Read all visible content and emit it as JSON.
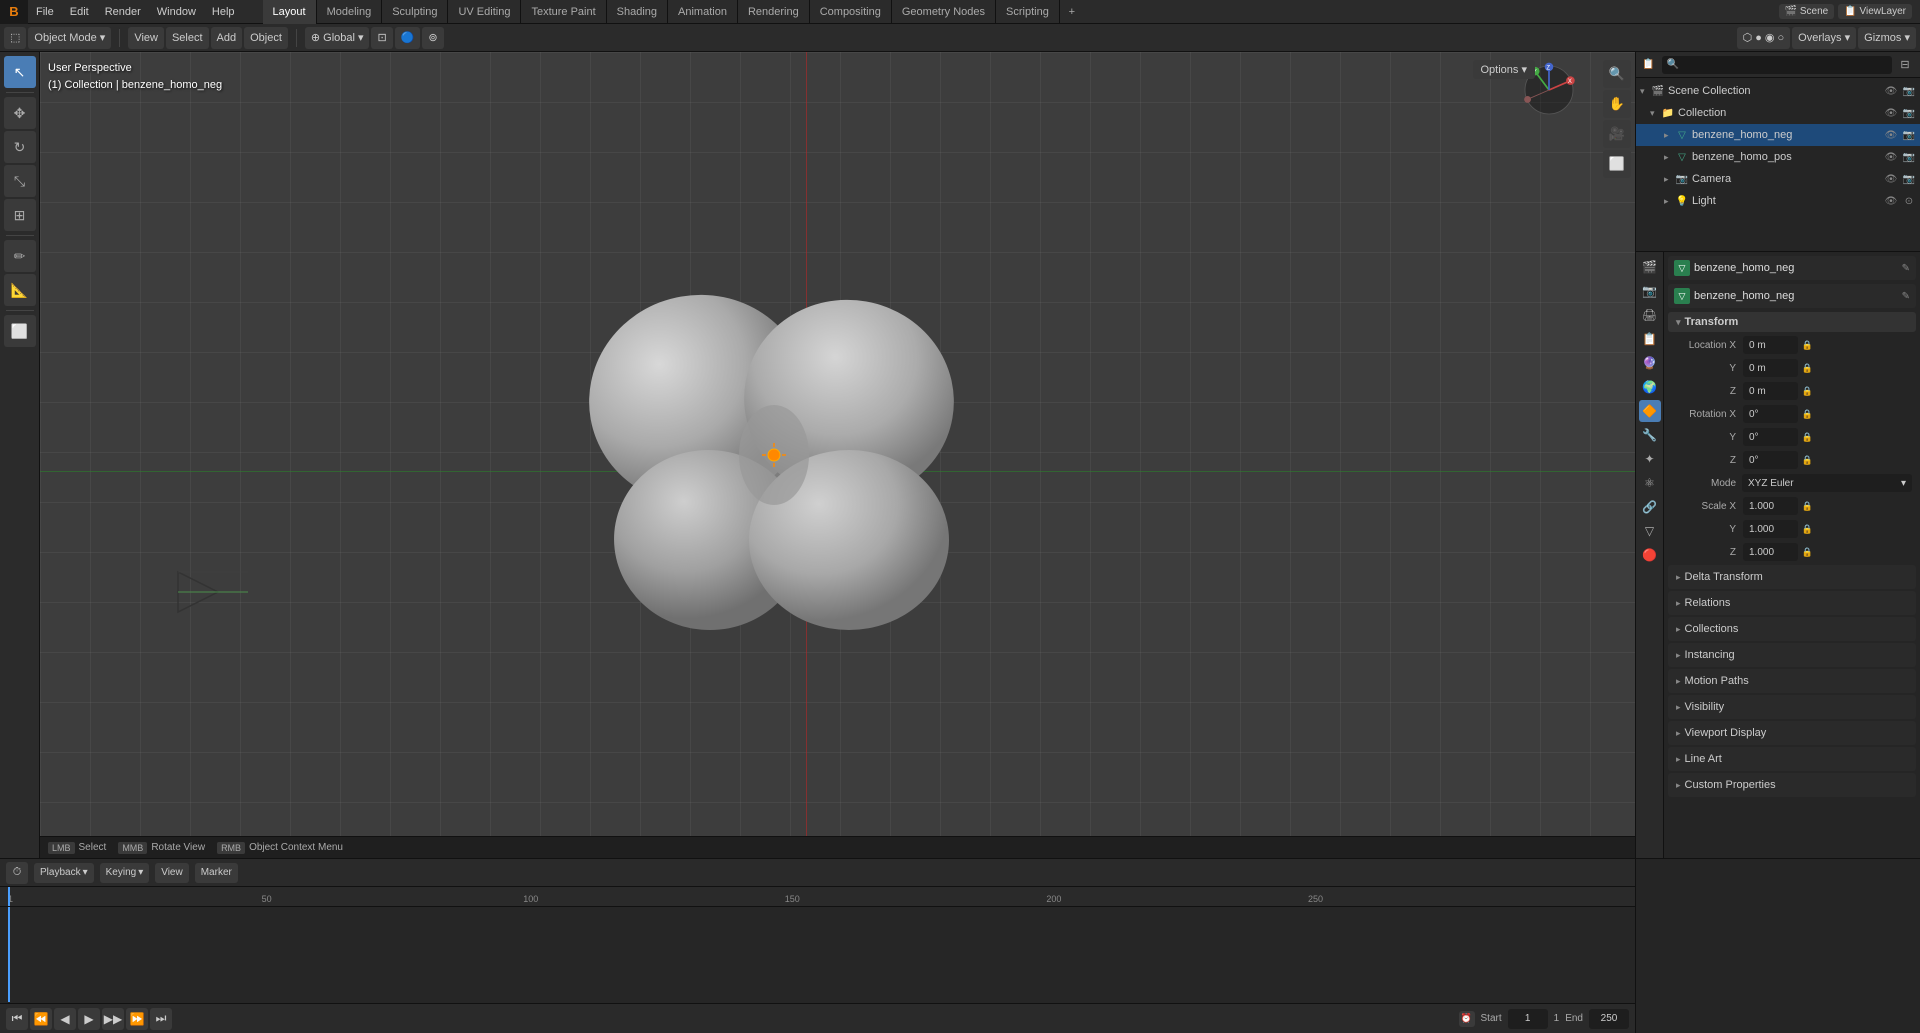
{
  "app": {
    "title": "Blender",
    "logo": "B"
  },
  "menubar": {
    "items": [
      "File",
      "Edit",
      "Render",
      "Window",
      "Help"
    ]
  },
  "workspace_tabs": {
    "tabs": [
      "Layout",
      "Modeling",
      "Sculpting",
      "UV Editing",
      "Texture Paint",
      "Shading",
      "Animation",
      "Rendering",
      "Compositing",
      "Geometry Nodes",
      "Scripting"
    ],
    "active": "Layout",
    "add_label": "+"
  },
  "header_toolbar": {
    "mode_label": "Object Mode",
    "viewport_label": "Global",
    "options_label": "Options ▾"
  },
  "viewport": {
    "info_line1": "User Perspective",
    "info_line2": "(1) Collection | benzene_homo_neg"
  },
  "outliner": {
    "title": "Scene Collection",
    "items": [
      {
        "name": "Collection",
        "type": "collection",
        "indent": 1,
        "expanded": true
      },
      {
        "name": "benzene_homo_neg",
        "type": "mesh",
        "indent": 2,
        "selected": true
      },
      {
        "name": "benzene_homo_pos",
        "type": "mesh",
        "indent": 2,
        "selected": false
      },
      {
        "name": "Camera",
        "type": "camera",
        "indent": 2,
        "selected": false
      },
      {
        "name": "Light",
        "type": "light",
        "indent": 2,
        "selected": false
      }
    ]
  },
  "properties": {
    "object_name": "benzene_homo_neg",
    "data_name": "benzene_homo_neg",
    "transform": {
      "label": "Transform",
      "location_x": "0 m",
      "location_y": "0 m",
      "location_z": "0 m",
      "rotation_x": "0°",
      "rotation_y": "0°",
      "rotation_z": "0°",
      "rotation_mode": "XYZ Euler",
      "scale_x": "1.000",
      "scale_y": "1.000",
      "scale_z": "1.000"
    },
    "sections": [
      {
        "label": "Delta Transform",
        "collapsed": true
      },
      {
        "label": "Relations",
        "collapsed": true
      },
      {
        "label": "Collections",
        "collapsed": true
      },
      {
        "label": "Instancing",
        "collapsed": true
      },
      {
        "label": "Motion Paths",
        "collapsed": true
      },
      {
        "label": "Visibility",
        "collapsed": true
      },
      {
        "label": "Viewport Display",
        "collapsed": true
      },
      {
        "label": "Line Art",
        "collapsed": true
      },
      {
        "label": "Custom Properties",
        "collapsed": true
      }
    ],
    "prop_icons": [
      "scene",
      "render",
      "output",
      "view_layer",
      "scene_data",
      "world",
      "object",
      "modifier",
      "particles",
      "physics",
      "constraints",
      "object_data",
      "material",
      "texture"
    ]
  },
  "timeline": {
    "playback_label": "Playback",
    "keying_label": "Keying",
    "view_label": "View",
    "marker_label": "Marker",
    "frame_current": "1",
    "frame_start_label": "Start",
    "frame_start": "1",
    "frame_end_label": "End",
    "frame_end": "250",
    "ticks": [
      "1",
      "50",
      "100",
      "150",
      "200",
      "250"
    ]
  },
  "statusbar": {
    "select_label": "Select",
    "rotate_label": "Rotate View",
    "context_label": "Object Context Menu"
  },
  "icons": {
    "cursor": "⊕",
    "move": "✥",
    "rotate": "↻",
    "scale": "⤡",
    "transform": "⊞",
    "annotate": "✏",
    "measure": "📏",
    "add_cube": "⬜",
    "search": "🔍",
    "hand": "✋",
    "camera_view": "🎥",
    "orthographic": "⊞",
    "eye": "👁",
    "filter": "⊟",
    "chevron_down": "▾",
    "chevron_right": "▸",
    "lock": "🔒",
    "close": "✕"
  }
}
